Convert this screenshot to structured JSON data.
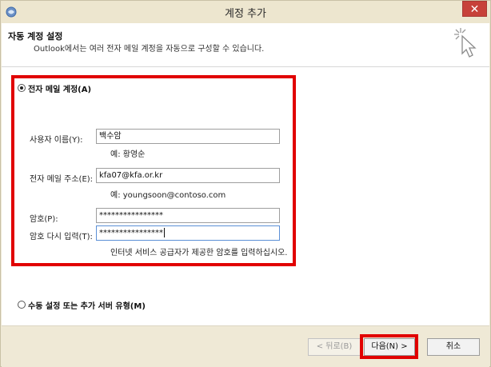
{
  "window": {
    "title": "계정 추가",
    "close_label": "✕"
  },
  "header": {
    "title": "자동 계정 설정",
    "subtitle": "Outlook에서는 여러 전자 메일 계정을 자동으로 구성할 수 있습니다."
  },
  "email_option": {
    "label": "전자 메일 계정(A)",
    "selected": true
  },
  "fields": {
    "name": {
      "label": "사용자 이름(Y):",
      "value": "백수암",
      "hint": "예: 황영순"
    },
    "email": {
      "label": "전자 메일 주소(E):",
      "value": "kfa07@kfa.or.kr",
      "hint": "예: youngsoon@contoso.com"
    },
    "password": {
      "label": "암호(P):",
      "value": "****************"
    },
    "password_confirm": {
      "label": "암호 다시 입력(T):",
      "value": "****************",
      "hint": "인터넷 서비스 공급자가 제공한 암호를 입력하십시오."
    }
  },
  "manual_option": {
    "label": "수동 설정 또는 추가 서버 유형(M)",
    "selected": false
  },
  "buttons": {
    "back": "< 뒤로(B)",
    "next": "다음(N) >",
    "cancel": "취소"
  },
  "colors": {
    "highlight": "#e10000",
    "close_button": "#c7413a",
    "dialog_background": "#efe9d6"
  }
}
